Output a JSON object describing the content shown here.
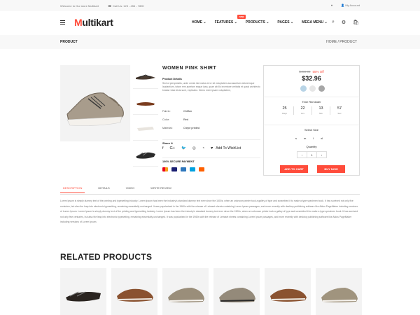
{
  "topbar": {
    "welcome": "Welcome to Our store Multikart",
    "phone": "Call Us: 123 - 456 - 7890",
    "account": "My Account"
  },
  "header": {
    "logo_m": "M",
    "logo_rest": "ultikart",
    "new_badge": "new",
    "nav": [
      "HOME",
      "FEATURES",
      "PRODUCTS",
      "PAGES",
      "MEGA MENU"
    ]
  },
  "breadcrumb": {
    "title": "PRODUCT",
    "path": "HOME / PRODUCT"
  },
  "product": {
    "title": "WOMEN PINK SHIRT",
    "details_heading": "Product Details",
    "details_text": "Sed ut perspiciatis, unde omnis iste natus error sit voluptatem accusantium doloremque laudantium, totam rem aperiam eaque ipsa, quae ab illo inventore veritatis et quasi architecto beatae vitae dicta sunt, explicabo. Nemo enim ipsam voluptatem,",
    "attributes": [
      {
        "k": "Fabric:",
        "v": "Chiffon"
      },
      {
        "k": "Color:",
        "v": "Red"
      },
      {
        "k": "Material:",
        "v": "Crepe printed"
      }
    ],
    "share_label": "Share It",
    "wishlist_label": "Add To WishList",
    "payment_heading": "100% SECURE PAYMENT"
  },
  "purchase": {
    "old_price": "$459.00",
    "discount": "55% Off",
    "price": "$32.96",
    "swatches": [
      "#b8d4e6",
      "#e6e6e6",
      "#a6a6a6"
    ],
    "timer_label": "Time Reminder",
    "timer": [
      {
        "n": "25",
        "u": "Days"
      },
      {
        "n": "22",
        "u": "Hrs"
      },
      {
        "n": "13",
        "u": "Min"
      },
      {
        "n": "57",
        "u": "Sec"
      }
    ],
    "size_label": "Select Size",
    "sizes": [
      "s",
      "m",
      "l",
      "xl"
    ],
    "qty_label": "Quantity",
    "qty": {
      "minus": "‹",
      "value": "1",
      "plus": "›"
    },
    "add_to_cart": "ADD TO CART",
    "buy_now": "BUY NOW"
  },
  "tabs": [
    "DESCRIPTION",
    "DETAILS",
    "VIDEO",
    "WRITE REVIEW"
  ],
  "description": "Lorem Ipsum is simply dummy text of the printing and typesetting industry. Lorem Ipsum has been the industry's standard dummy text ever since the 1500s, when an unknown printer took a galley of type and scrambled it to make a type specimen book. It has survived not only five centuries, but also the leap into electronic typesetting, remaining essentially unchanged. It was popularised in the 1960s with the release of Letraset sheets containing Lorem Ipsum passages, and more recently with desktop publishing software like Aldus PageMaker including versions of Lorem Ipsum. Lorem Ipsum is simply dummy text of the printing and typesetting industry. Lorem Ipsum has been the industry's standard dummy text ever since the 1500s, when an unknown printer took a galley of type and scrambled it to make a type specimen book. It has survived not only five centuries, but also the leap into electronic typesetting, remaining essentially unchanged. It was popularised in the 1960s with the release of Letraset sheets containing Lorem Ipsum passages, and more recently with desktop publishing software like Aldus PageMaker including versions of Lorem Ipsum.",
  "related": {
    "heading": "RELATED PRODUCTS"
  },
  "colors": {
    "accent": "#ff4c3b"
  }
}
